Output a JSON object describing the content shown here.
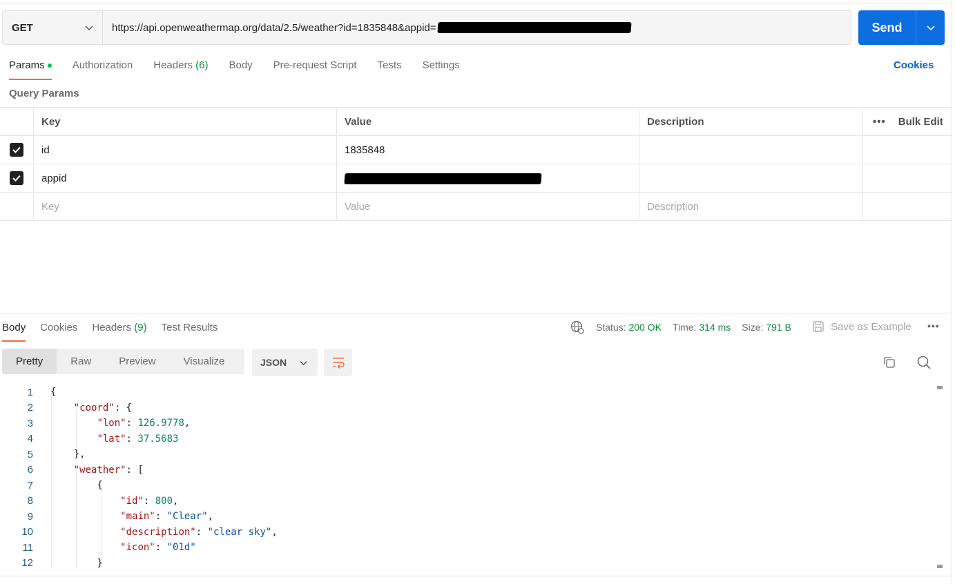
{
  "request": {
    "method": "GET",
    "url_prefix": "https://api.openweathermap.org/data/2.5/weather?id=1835848&appid=",
    "send_label": "Send"
  },
  "req_tabs": {
    "params": "Params",
    "authorization": "Authorization",
    "headers": "Headers",
    "headers_count": "(6)",
    "body": "Body",
    "prerequest": "Pre-request Script",
    "tests": "Tests",
    "settings": "Settings",
    "cookies": "Cookies"
  },
  "query_params": {
    "title": "Query Params",
    "col_key": "Key",
    "col_value": "Value",
    "col_description": "Description",
    "more": "•••",
    "bulk_edit": "Bulk Edit",
    "rows": [
      {
        "key": "id",
        "value": "1835848",
        "description": ""
      },
      {
        "key": "appid",
        "value": "",
        "description": ""
      }
    ],
    "placeholder_key": "Key",
    "placeholder_value": "Value",
    "placeholder_description": "Description"
  },
  "response": {
    "tabs": {
      "body": "Body",
      "cookies": "Cookies",
      "headers": "Headers",
      "headers_count": "(9)",
      "test_results": "Test Results"
    },
    "status_label": "Status:",
    "status_value": "200 OK",
    "time_label": "Time:",
    "time_value": "314 ms",
    "size_label": "Size:",
    "size_value": "791 B",
    "save_example": "Save as Example",
    "more": "•••",
    "views": [
      "Pretty",
      "Raw",
      "Preview",
      "Visualize"
    ],
    "format": "JSON"
  },
  "code_lines": [
    "1",
    "2",
    "3",
    "4",
    "5",
    "6",
    "7",
    "8",
    "9",
    "10",
    "11",
    "12"
  ],
  "json": {
    "coord_key": "\"coord\"",
    "lon_key": "\"lon\"",
    "lon_val": "126.9778",
    "lat_key": "\"lat\"",
    "lat_val": "37.5683",
    "weather_key": "\"weather\"",
    "id_key": "\"id\"",
    "id_val": "800",
    "main_key": "\"main\"",
    "main_val": "\"Clear\"",
    "desc_key": "\"description\"",
    "desc_val": "\"clear sky\"",
    "icon_key": "\"icon\"",
    "icon_val": "\"01d\""
  },
  "colors": {
    "accent_orange": "#f26b3a",
    "send_blue": "#0d6ee2",
    "success_green": "#0c8a3a"
  }
}
